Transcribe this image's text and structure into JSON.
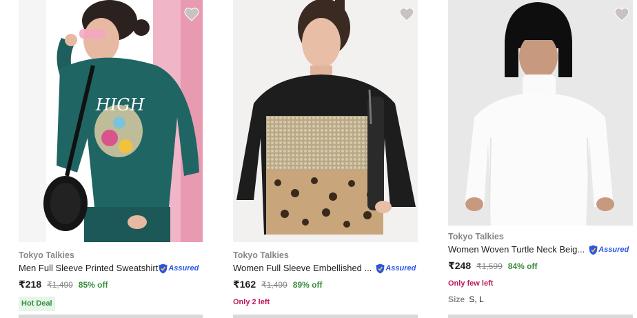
{
  "products": [
    {
      "brand": "Tokyo Talkies",
      "title": "Men Full Sleeve Printed Sweatshirt",
      "assured": "Assured",
      "price": "₹218",
      "mrp": "₹1,499",
      "off": "85% off",
      "badge": "Hot Deal",
      "image_icon": "green-printed-sweatshirt-photo"
    },
    {
      "brand": "Tokyo Talkies",
      "title": "Women Full Sleeve Embellished ...",
      "assured": "Assured",
      "price": "₹162",
      "mrp": "₹1,499",
      "off": "89% off",
      "stock": "Only 2 left",
      "image_icon": "black-sequin-leopard-sweatshirt-photo"
    },
    {
      "brand": "Tokyo Talkies",
      "title": "Women Woven Turtle Neck Beig...",
      "assured": "Assured",
      "price": "₹248",
      "mrp": "₹1,599",
      "off": "84% off",
      "stock": "Only few left",
      "size_label": "Size",
      "size_value": "S, L",
      "image_icon": "white-turtleneck-photo"
    }
  ],
  "colors": {
    "wishlist": "#c8c2c2",
    "discount": "#388e3c",
    "stock": "#c2185b",
    "assured": "#2a55e5"
  }
}
